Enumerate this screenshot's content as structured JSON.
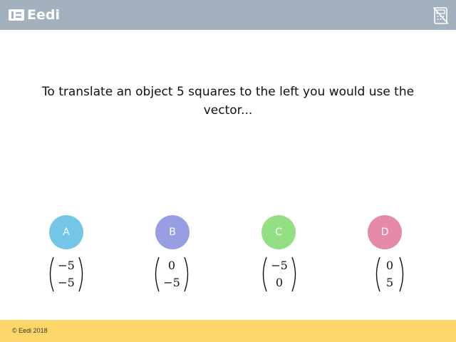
{
  "header": {
    "brand": "Eedi",
    "bg_color": "#a3b1bf",
    "calculator_icon": "calculator-disabled-icon"
  },
  "question": {
    "text": "To translate an object 5 squares to the left you would use the vector..."
  },
  "options": [
    {
      "letter": "A",
      "color": "#74c6e6",
      "top": "−5",
      "bottom": "−5"
    },
    {
      "letter": "B",
      "color": "#979fe2",
      "top": "0",
      "bottom": "−5"
    },
    {
      "letter": "C",
      "color": "#94df84",
      "top": "−5",
      "bottom": "0"
    },
    {
      "letter": "D",
      "color": "#e68aa9",
      "top": "0",
      "bottom": "5"
    }
  ],
  "footer": {
    "copyright": "© Eedi 2018",
    "bg_color": "#fdd66a"
  }
}
